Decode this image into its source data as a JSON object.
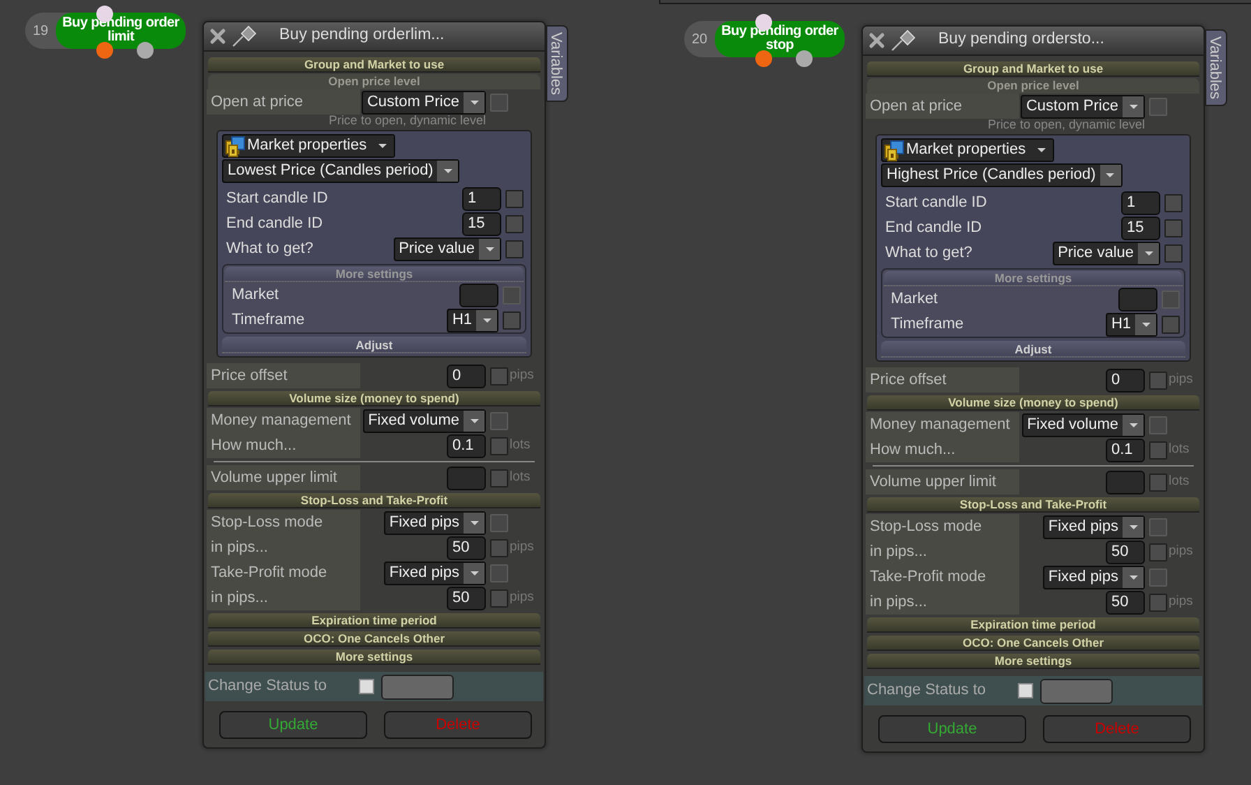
{
  "nodes": [
    {
      "number": "19",
      "label": "Buy pending order limit"
    },
    {
      "number": "20",
      "label": "Buy pending order stop"
    }
  ],
  "panels": [
    {
      "title": "Buy pending orderlim...",
      "side_tab": "Variables",
      "items": [
        {
          "kind": "header",
          "text": "Group and Market to use"
        },
        {
          "kind": "subheader",
          "text": "Open price level"
        },
        {
          "kind": "row",
          "label": "Open at price",
          "control": {
            "kind": "select",
            "value": "Custom Price"
          },
          "checkbox_disabled": true
        },
        {
          "kind": "hint",
          "text": "Price to open, dynamic level"
        },
        {
          "kind": "group",
          "children": [
            {
              "kind": "picker",
              "value": "Market properties"
            },
            {
              "kind": "wide-select",
              "value": "Lowest Price (Candles period)"
            },
            {
              "kind": "row",
              "label": "Start candle ID",
              "control": {
                "kind": "input",
                "value": "1"
              },
              "checkbox_disabled": false
            },
            {
              "kind": "row",
              "label": "End candle ID",
              "control": {
                "kind": "input",
                "value": "15"
              },
              "checkbox_disabled": false
            },
            {
              "kind": "row",
              "label": "What to get?",
              "control": {
                "kind": "select",
                "value": "Price value"
              },
              "checkbox_disabled": false
            },
            {
              "kind": "subgroup",
              "title": "More settings",
              "children": [
                {
                  "kind": "row",
                  "label": "Market",
                  "control": {
                    "kind": "input"
                  },
                  "checkbox_disabled": true
                },
                {
                  "kind": "row",
                  "label": "Timeframe",
                  "control": {
                    "kind": "select",
                    "value": "H1"
                  },
                  "checkbox_disabled": false
                }
              ]
            },
            {
              "kind": "group-header",
              "text": "Adjust"
            }
          ]
        },
        {
          "kind": "row",
          "label": "Price offset",
          "control": {
            "kind": "input",
            "value": "0"
          },
          "checkbox_disabled": false,
          "unit": "pips"
        },
        {
          "kind": "header",
          "text": "Volume size (money to spend)"
        },
        {
          "kind": "row",
          "label": "Money management",
          "control": {
            "kind": "select",
            "value": "Fixed volume"
          },
          "checkbox_disabled": true
        },
        {
          "kind": "row",
          "label": "How much...",
          "control": {
            "kind": "input",
            "value": "0.1"
          },
          "checkbox_disabled": false,
          "unit": "lots"
        },
        {
          "kind": "rule"
        },
        {
          "kind": "row",
          "label": "Volume upper limit",
          "control": {
            "kind": "input"
          },
          "checkbox_disabled": false,
          "unit": "lots"
        },
        {
          "kind": "header",
          "text": "Stop-Loss and Take-Profit"
        },
        {
          "kind": "row",
          "label": "Stop-Loss mode",
          "control": {
            "kind": "select",
            "value": "Fixed pips"
          },
          "checkbox_disabled": true
        },
        {
          "kind": "row",
          "label": "in pips...",
          "control": {
            "kind": "input",
            "value": "50"
          },
          "checkbox_disabled": false,
          "unit": "pips"
        },
        {
          "kind": "row",
          "label": "Take-Profit mode",
          "control": {
            "kind": "select",
            "value": "Fixed pips"
          },
          "checkbox_disabled": true
        },
        {
          "kind": "row",
          "label": "in pips...",
          "control": {
            "kind": "input",
            "value": "50"
          },
          "checkbox_disabled": false,
          "unit": "pips"
        },
        {
          "kind": "header",
          "text": "Expiration time period"
        },
        {
          "kind": "header",
          "text": "OCO: One Cancels Other"
        },
        {
          "kind": "header",
          "text": "More settings"
        }
      ],
      "status": {
        "label": "Change Status to",
        "checked": false
      },
      "buttons": [
        {
          "label": "Update",
          "kind": "confirm"
        },
        {
          "label": "Delete",
          "kind": "danger"
        }
      ]
    },
    {
      "title": "Buy pending ordersto...",
      "side_tab": "Variables",
      "items": [
        {
          "kind": "header",
          "text": "Group and Market to use"
        },
        {
          "kind": "subheader",
          "text": "Open price level"
        },
        {
          "kind": "row",
          "label": "Open at price",
          "control": {
            "kind": "select",
            "value": "Custom Price"
          },
          "checkbox_disabled": true
        },
        {
          "kind": "hint",
          "text": "Price to open, dynamic level"
        },
        {
          "kind": "group",
          "children": [
            {
              "kind": "picker",
              "value": "Market properties"
            },
            {
              "kind": "wide-select",
              "value": "Highest Price (Candles period)"
            },
            {
              "kind": "row",
              "label": "Start candle ID",
              "control": {
                "kind": "input",
                "value": "1"
              },
              "checkbox_disabled": false
            },
            {
              "kind": "row",
              "label": "End candle ID",
              "control": {
                "kind": "input",
                "value": "15"
              },
              "checkbox_disabled": false
            },
            {
              "kind": "row",
              "label": "What to get?",
              "control": {
                "kind": "select",
                "value": "Price value"
              },
              "checkbox_disabled": false
            },
            {
              "kind": "subgroup",
              "title": "More settings",
              "children": [
                {
                  "kind": "row",
                  "label": "Market",
                  "control": {
                    "kind": "input"
                  },
                  "checkbox_disabled": true
                },
                {
                  "kind": "row",
                  "label": "Timeframe",
                  "control": {
                    "kind": "select",
                    "value": "H1"
                  },
                  "checkbox_disabled": false
                }
              ]
            },
            {
              "kind": "group-header",
              "text": "Adjust"
            }
          ]
        },
        {
          "kind": "row",
          "label": "Price offset",
          "control": {
            "kind": "input",
            "value": "0"
          },
          "checkbox_disabled": false,
          "unit": "pips"
        },
        {
          "kind": "header",
          "text": "Volume size (money to spend)"
        },
        {
          "kind": "row",
          "label": "Money management",
          "control": {
            "kind": "select",
            "value": "Fixed volume"
          },
          "checkbox_disabled": true
        },
        {
          "kind": "row",
          "label": "How much...",
          "control": {
            "kind": "input",
            "value": "0.1"
          },
          "checkbox_disabled": false,
          "unit": "lots"
        },
        {
          "kind": "rule"
        },
        {
          "kind": "row",
          "label": "Volume upper limit",
          "control": {
            "kind": "input"
          },
          "checkbox_disabled": false,
          "unit": "lots"
        },
        {
          "kind": "header",
          "text": "Stop-Loss and Take-Profit"
        },
        {
          "kind": "row",
          "label": "Stop-Loss mode",
          "control": {
            "kind": "select",
            "value": "Fixed pips"
          },
          "checkbox_disabled": true
        },
        {
          "kind": "row",
          "label": "in pips...",
          "control": {
            "kind": "input",
            "value": "50"
          },
          "checkbox_disabled": false,
          "unit": "pips"
        },
        {
          "kind": "row",
          "label": "Take-Profit mode",
          "control": {
            "kind": "select",
            "value": "Fixed pips"
          },
          "checkbox_disabled": true
        },
        {
          "kind": "row",
          "label": "in pips...",
          "control": {
            "kind": "input",
            "value": "50"
          },
          "checkbox_disabled": false,
          "unit": "pips"
        },
        {
          "kind": "header",
          "text": "Expiration time period"
        },
        {
          "kind": "header",
          "text": "OCO: One Cancels Other"
        },
        {
          "kind": "header",
          "text": "More settings"
        }
      ],
      "status": {
        "label": "Change Status to",
        "checked": false
      },
      "buttons": [
        {
          "label": "Update",
          "kind": "confirm"
        },
        {
          "label": "Delete",
          "kind": "danger"
        }
      ]
    }
  ]
}
